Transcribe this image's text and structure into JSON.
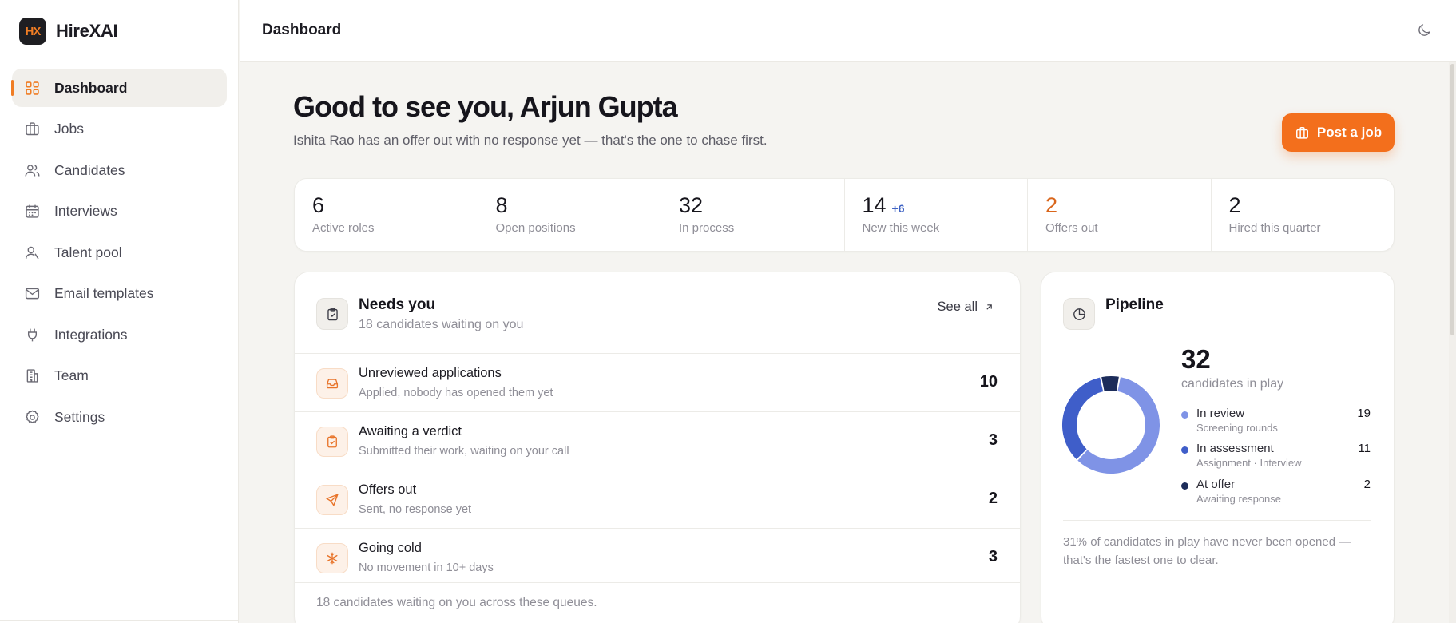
{
  "app": {
    "brand_name": "HireXAI",
    "brand_mark": "HX",
    "accent_color": "#f36f1c"
  },
  "sidebar": {
    "items": [
      {
        "label": "Dashboard",
        "icon": "grid-icon",
        "active": true
      },
      {
        "label": "Jobs",
        "icon": "briefcase-icon",
        "active": false
      },
      {
        "label": "Candidates",
        "icon": "users-icon",
        "active": false
      },
      {
        "label": "Interviews",
        "icon": "calendar-icon",
        "active": false
      },
      {
        "label": "Talent pool",
        "icon": "user-search-icon",
        "active": false
      },
      {
        "label": "Email templates",
        "icon": "mail-icon",
        "active": false
      },
      {
        "label": "Integrations",
        "icon": "plug-icon",
        "active": false
      },
      {
        "label": "Team",
        "icon": "building-icon",
        "active": false
      },
      {
        "label": "Settings",
        "icon": "gear-icon",
        "active": false
      }
    ]
  },
  "header": {
    "title": "Dashboard",
    "theme_toggle_icon": "moon-icon"
  },
  "main": {
    "greeting": "Good to see you, Arjun Gupta",
    "sub_greeting": "Ishita Rao has an offer out with no response yet — that's the one to chase first.",
    "post_job_label": "Post a job"
  },
  "stats": [
    {
      "value": "6",
      "label": "Active roles"
    },
    {
      "value": "8",
      "label": "Open positions"
    },
    {
      "value": "32",
      "label": "In process"
    },
    {
      "value": "14",
      "delta": "+6",
      "label": "New this week"
    },
    {
      "value": "2",
      "label": "Offers out",
      "accent": true
    },
    {
      "value": "2",
      "label": "Hired this quarter"
    }
  ],
  "needs_you": {
    "title": "Needs you",
    "subtitle": "18 candidates waiting on you",
    "see_all_label": "See all",
    "queues": [
      {
        "title": "Unreviewed applications",
        "sub": "Applied, nobody has opened them yet",
        "count": "10",
        "icon": "inbox-icon"
      },
      {
        "title": "Awaiting a verdict",
        "sub": "Submitted their work, waiting on your call",
        "count": "3",
        "icon": "clipboard-check-icon"
      },
      {
        "title": "Offers out",
        "sub": "Sent, no response yet",
        "count": "2",
        "icon": "send-icon"
      },
      {
        "title": "Going cold",
        "sub": "No movement in 10+ days",
        "count": "3",
        "icon": "snowflake-icon"
      }
    ],
    "footer": "18 candidates waiting on you across these queues."
  },
  "pipeline": {
    "title": "Pipeline",
    "total": "32",
    "total_label": "candidates in play",
    "stages": [
      {
        "name": "In review",
        "sub": "Screening rounds",
        "value": 19,
        "color": "#7f93e6"
      },
      {
        "name": "In assessment",
        "sub": "Assignment · Interview",
        "value": 11,
        "color": "#3f5ec9"
      },
      {
        "name": "At offer",
        "sub": "Awaiting response",
        "value": 2,
        "color": "#1c2c5a"
      }
    ],
    "note": "31% of candidates in play have never been opened — that's the fastest one to clear."
  }
}
